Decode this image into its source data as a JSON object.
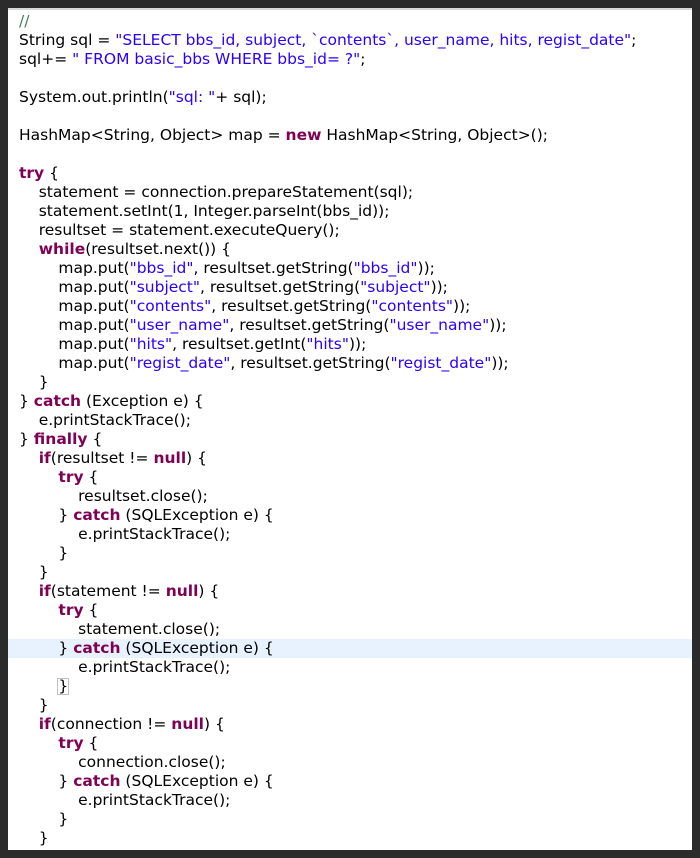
{
  "editor": {
    "lines": [
      {
        "tokens": [
          {
            "t": "// ",
            "c": "cmt"
          }
        ]
      },
      {
        "tokens": [
          {
            "t": "String sql = ",
            "c": ""
          },
          {
            "t": "\"SELECT bbs_id, subject, `contents`, user_name, hits, regist_date\"",
            "c": "str"
          },
          {
            "t": ";",
            "c": ""
          }
        ]
      },
      {
        "tokens": [
          {
            "t": "sql+= ",
            "c": ""
          },
          {
            "t": "\" FROM basic_bbs WHERE bbs_id= ?\"",
            "c": "str"
          },
          {
            "t": ";",
            "c": ""
          }
        ]
      },
      {
        "tokens": []
      },
      {
        "tokens": [
          {
            "t": "System.out.println(",
            "c": ""
          },
          {
            "t": "\"sql: \"",
            "c": "str"
          },
          {
            "t": "+ sql);",
            "c": ""
          }
        ]
      },
      {
        "tokens": []
      },
      {
        "tokens": [
          {
            "t": "HashMap<String, Object> map = ",
            "c": ""
          },
          {
            "t": "new",
            "c": "kw"
          },
          {
            "t": " HashMap<String, Object>();",
            "c": ""
          }
        ]
      },
      {
        "tokens": []
      },
      {
        "tokens": [
          {
            "t": "try",
            "c": "kw"
          },
          {
            "t": " {",
            "c": ""
          }
        ]
      },
      {
        "tokens": [
          {
            "t": "    statement = connection.prepareStatement(sql);",
            "c": ""
          }
        ]
      },
      {
        "tokens": [
          {
            "t": "    statement.setInt(1, Integer.parseInt(bbs_id));",
            "c": ""
          }
        ]
      },
      {
        "tokens": [
          {
            "t": "    resultset = statement.executeQuery();",
            "c": ""
          }
        ]
      },
      {
        "tokens": [
          {
            "t": "    ",
            "c": ""
          },
          {
            "t": "while",
            "c": "kw"
          },
          {
            "t": "(resultset.next()) {",
            "c": ""
          }
        ]
      },
      {
        "tokens": [
          {
            "t": "        map.put(",
            "c": ""
          },
          {
            "t": "\"bbs_id\"",
            "c": "str"
          },
          {
            "t": ", resultset.getString(",
            "c": ""
          },
          {
            "t": "\"bbs_id\"",
            "c": "str"
          },
          {
            "t": "));",
            "c": ""
          }
        ]
      },
      {
        "tokens": [
          {
            "t": "        map.put(",
            "c": ""
          },
          {
            "t": "\"subject\"",
            "c": "str"
          },
          {
            "t": ", resultset.getString(",
            "c": ""
          },
          {
            "t": "\"subject\"",
            "c": "str"
          },
          {
            "t": "));",
            "c": ""
          }
        ]
      },
      {
        "tokens": [
          {
            "t": "        map.put(",
            "c": ""
          },
          {
            "t": "\"contents\"",
            "c": "str"
          },
          {
            "t": ", resultset.getString(",
            "c": ""
          },
          {
            "t": "\"contents\"",
            "c": "str"
          },
          {
            "t": "));",
            "c": ""
          }
        ]
      },
      {
        "tokens": [
          {
            "t": "        map.put(",
            "c": ""
          },
          {
            "t": "\"user_name\"",
            "c": "str"
          },
          {
            "t": ", resultset.getString(",
            "c": ""
          },
          {
            "t": "\"user_name\"",
            "c": "str"
          },
          {
            "t": "));",
            "c": ""
          }
        ]
      },
      {
        "tokens": [
          {
            "t": "        map.put(",
            "c": ""
          },
          {
            "t": "\"hits\"",
            "c": "str"
          },
          {
            "t": ", resultset.getInt(",
            "c": ""
          },
          {
            "t": "\"hits\"",
            "c": "str"
          },
          {
            "t": "));",
            "c": ""
          }
        ]
      },
      {
        "tokens": [
          {
            "t": "        map.put(",
            "c": ""
          },
          {
            "t": "\"regist_date\"",
            "c": "str"
          },
          {
            "t": ", resultset.getString(",
            "c": ""
          },
          {
            "t": "\"regist_date\"",
            "c": "str"
          },
          {
            "t": "));",
            "c": ""
          }
        ]
      },
      {
        "tokens": [
          {
            "t": "    }",
            "c": ""
          }
        ]
      },
      {
        "tokens": [
          {
            "t": "} ",
            "c": ""
          },
          {
            "t": "catch",
            "c": "kw"
          },
          {
            "t": " (Exception e) {",
            "c": ""
          }
        ]
      },
      {
        "tokens": [
          {
            "t": "    e.printStackTrace();",
            "c": ""
          }
        ]
      },
      {
        "tokens": [
          {
            "t": "} ",
            "c": ""
          },
          {
            "t": "finally",
            "c": "kw"
          },
          {
            "t": " {",
            "c": ""
          }
        ]
      },
      {
        "tokens": [
          {
            "t": "    ",
            "c": ""
          },
          {
            "t": "if",
            "c": "kw"
          },
          {
            "t": "(resultset != ",
            "c": ""
          },
          {
            "t": "null",
            "c": "kw"
          },
          {
            "t": ") {",
            "c": ""
          }
        ]
      },
      {
        "tokens": [
          {
            "t": "        ",
            "c": ""
          },
          {
            "t": "try",
            "c": "kw"
          },
          {
            "t": " {",
            "c": ""
          }
        ]
      },
      {
        "tokens": [
          {
            "t": "            resultset.close();",
            "c": ""
          }
        ]
      },
      {
        "tokens": [
          {
            "t": "        } ",
            "c": ""
          },
          {
            "t": "catch",
            "c": "kw"
          },
          {
            "t": " (SQLException e) {",
            "c": ""
          }
        ]
      },
      {
        "tokens": [
          {
            "t": "            e.printStackTrace();",
            "c": ""
          }
        ]
      },
      {
        "tokens": [
          {
            "t": "        }",
            "c": ""
          }
        ]
      },
      {
        "tokens": [
          {
            "t": "    }",
            "c": ""
          }
        ]
      },
      {
        "tokens": [
          {
            "t": "    ",
            "c": ""
          },
          {
            "t": "if",
            "c": "kw"
          },
          {
            "t": "(statement != ",
            "c": ""
          },
          {
            "t": "null",
            "c": "kw"
          },
          {
            "t": ") {",
            "c": ""
          }
        ]
      },
      {
        "tokens": [
          {
            "t": "        ",
            "c": ""
          },
          {
            "t": "try",
            "c": "kw"
          },
          {
            "t": " {",
            "c": ""
          }
        ]
      },
      {
        "tokens": [
          {
            "t": "            statement.close();",
            "c": ""
          }
        ]
      },
      {
        "highlight": true,
        "tokens": [
          {
            "t": "        } ",
            "c": ""
          },
          {
            "t": "catch",
            "c": "kw"
          },
          {
            "t": " (SQLException e) {",
            "c": ""
          }
        ]
      },
      {
        "tokens": [
          {
            "t": "            e.printStackTrace();",
            "c": ""
          }
        ]
      },
      {
        "tokens": [
          {
            "t": "        ",
            "c": ""
          },
          {
            "t": "}",
            "c": "caret"
          }
        ]
      },
      {
        "tokens": [
          {
            "t": "    }",
            "c": ""
          }
        ]
      },
      {
        "tokens": [
          {
            "t": "    ",
            "c": ""
          },
          {
            "t": "if",
            "c": "kw"
          },
          {
            "t": "(connection != ",
            "c": ""
          },
          {
            "t": "null",
            "c": "kw"
          },
          {
            "t": ") {",
            "c": ""
          }
        ]
      },
      {
        "tokens": [
          {
            "t": "        ",
            "c": ""
          },
          {
            "t": "try",
            "c": "kw"
          },
          {
            "t": " {",
            "c": ""
          }
        ]
      },
      {
        "tokens": [
          {
            "t": "            connection.close();",
            "c": ""
          }
        ]
      },
      {
        "tokens": [
          {
            "t": "        } ",
            "c": ""
          },
          {
            "t": "catch",
            "c": "kw"
          },
          {
            "t": " (SQLException e) {",
            "c": ""
          }
        ]
      },
      {
        "tokens": [
          {
            "t": "            e.printStackTrace();",
            "c": ""
          }
        ]
      },
      {
        "tokens": [
          {
            "t": "        }",
            "c": ""
          }
        ]
      },
      {
        "tokens": [
          {
            "t": "    }",
            "c": ""
          }
        ]
      },
      {
        "tokens": [
          {
            "t": "}",
            "c": ""
          }
        ]
      }
    ]
  }
}
